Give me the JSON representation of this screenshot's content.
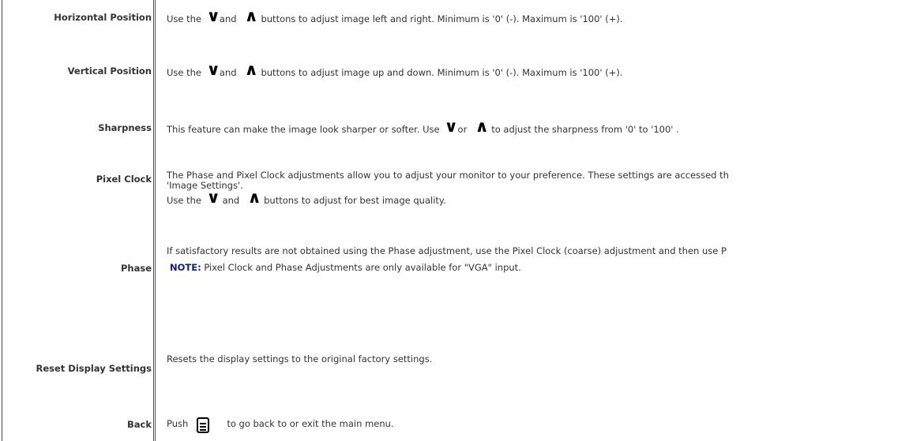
{
  "rows": {
    "horizontal_position": {
      "label": "Horizontal Position",
      "text_before": "Use the",
      "text_and": "and",
      "text_after": "buttons to adjust image left and right. Minimum is '0' (-). Maximum is '100' (+)."
    },
    "vertical_position": {
      "label": "Vertical Position",
      "text_before": "Use the",
      "text_and": "and",
      "text_after": "buttons to adjust image up and down. Minimum is '0' (-). Maximum is '100' (+)."
    },
    "sharpness": {
      "label": "Sharpness",
      "text_before": "This feature can make the image look sharper or softer. Use",
      "text_or": "or",
      "text_after": "to adjust the sharpness from '0' to '100' ."
    },
    "pixel_clock": {
      "label": "Pixel Clock",
      "line1": "The Phase and Pixel Clock adjustments allow you to adjust your monitor to your preference. These settings are accessed th",
      "line2": "'Image Settings'.",
      "text_before": "Use the",
      "text_and": "and",
      "text_after": "buttons to adjust for best image quality."
    },
    "phase": {
      "label": "Phase",
      "line1": "If satisfactory results are not obtained using the Phase adjustment, use the Pixel Clock (coarse) adjustment and then use P",
      "note_label": "NOTE:",
      "note_text": "Pixel Clock and Phase Adjustments are only available for \"VGA\" input."
    },
    "reset": {
      "label": "Reset Display Settings",
      "text": "Resets the display settings to the original factory settings."
    },
    "back": {
      "label": "Back",
      "text_before": "Push",
      "text_after": "to go back to or exit the main menu."
    }
  },
  "icons": {
    "down": "down-arrow-icon",
    "up": "up-arrow-icon",
    "menu": "menu-button-icon"
  },
  "colors": {
    "note_label": "#0b1f85",
    "text": "#333333"
  }
}
